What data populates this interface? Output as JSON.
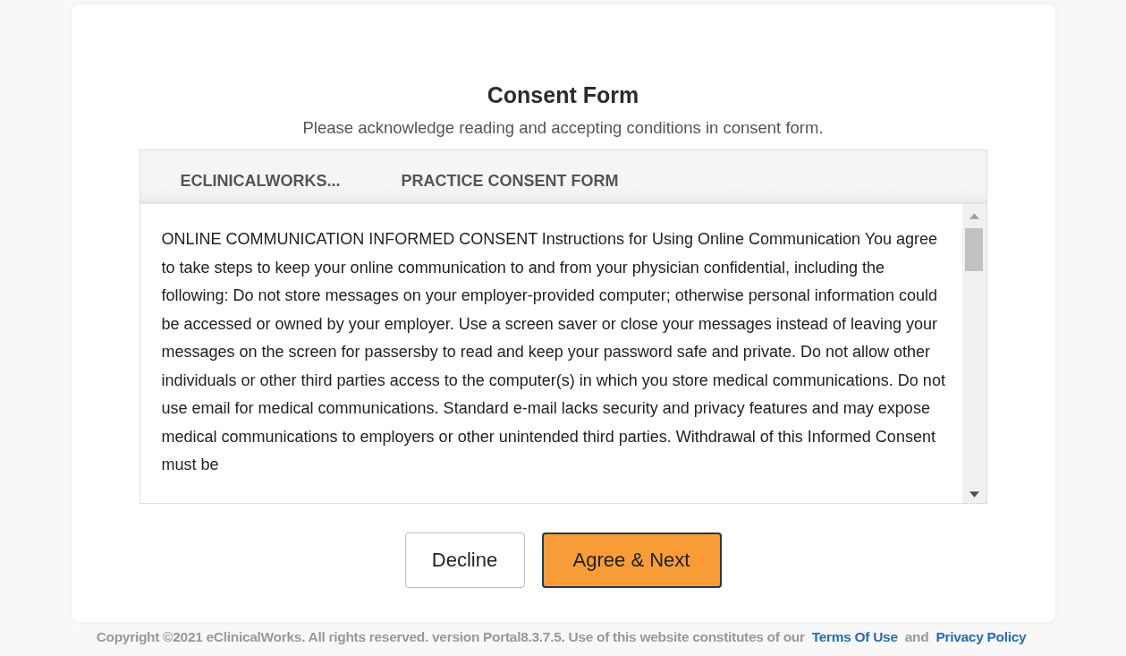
{
  "title": "Consent Form",
  "subtitle": "Please acknowledge reading and accepting conditions in consent form.",
  "tabs": [
    {
      "label": "ECLINICALWORKS..."
    },
    {
      "label": "PRACTICE CONSENT FORM"
    }
  ],
  "body": "ONLINE COMMUNICATION INFORMED CONSENT Instructions for Using Online Communication You agree to take steps to keep your online communication to and from your physician confidential, including the following: Do not store messages on your employer-provided computer; otherwise personal information could be accessed or owned by your employer. Use a screen saver or close your messages instead of leaving your messages on the screen for passersby to read and keep your password safe and private. Do not allow other individuals or other third parties access to the computer(s) in which you store medical communications. Do not use email for medical communications. Standard e-mail lacks security and privacy features and may expose medical communications to employers or other unintended third parties. Withdrawal of this Informed Consent must be",
  "buttons": [
    {
      "label": "Decline",
      "kind": "secondary"
    },
    {
      "label": "Agree & Next",
      "kind": "primary"
    }
  ],
  "footer": {
    "text": "Copyright ©2021 eClinicalWorks. All rights reserved. version Portal8.3.7.5.  Use of this website constitutes of our",
    "links": [
      {
        "label": "Terms Of Use"
      },
      {
        "label": "Privacy Policy"
      }
    ],
    "joiner": "and"
  }
}
